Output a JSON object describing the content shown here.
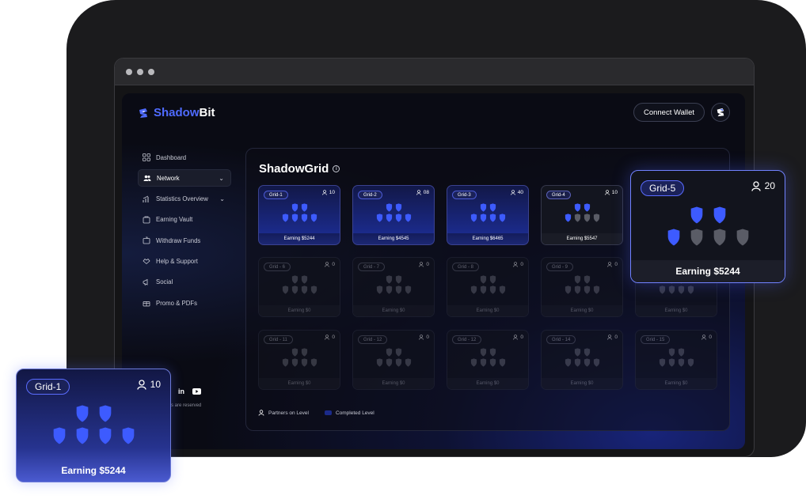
{
  "brand": {
    "name_part1": "Shadow",
    "name_part2": "Bit"
  },
  "header": {
    "connect_label": "Connect Wallet"
  },
  "sidebar": {
    "items": [
      {
        "label": "Dashboard",
        "icon": "dashboard-icon"
      },
      {
        "label": "Network",
        "icon": "users-icon",
        "active": true,
        "expandable": true
      },
      {
        "label": "Statistics Overview",
        "icon": "chart-icon",
        "expandable": true
      },
      {
        "label": "Earning Vault",
        "icon": "vault-icon"
      },
      {
        "label": "Withdraw Funds",
        "icon": "wallet-icon"
      },
      {
        "label": "Help & Support",
        "icon": "support-icon"
      },
      {
        "label": "Social",
        "icon": "megaphone-icon"
      },
      {
        "label": "Promo & PDFs",
        "icon": "gift-icon"
      }
    ],
    "rights_text": "s are reserved"
  },
  "panel": {
    "title": "ShadowGrid"
  },
  "grids": [
    {
      "label": "Grid-1",
      "count": "10",
      "earning": "Earning $5244",
      "state": "on",
      "filled": 6
    },
    {
      "label": "Grid-2",
      "count": "08",
      "earning": "Earning $4545",
      "state": "on",
      "filled": 6
    },
    {
      "label": "Grid-3",
      "count": "40",
      "earning": "Earning $6465",
      "state": "on",
      "filled": 6
    },
    {
      "label": "Grid-4",
      "count": "10",
      "earning": "Earning $5547",
      "state": "mixed",
      "filled": 3
    },
    {
      "label": "Grid - 6",
      "count": "0",
      "earning": "Earning $0",
      "state": "off",
      "filled": 0
    },
    {
      "label": "Grid - 7",
      "count": "0",
      "earning": "Earning $0",
      "state": "off",
      "filled": 0
    },
    {
      "label": "Grid - 8",
      "count": "0",
      "earning": "Earning $0",
      "state": "off",
      "filled": 0
    },
    {
      "label": "Grid - 9",
      "count": "0",
      "earning": "Earning $0",
      "state": "off",
      "filled": 0
    },
    {
      "label": "",
      "count": "",
      "earning": "Earning $0",
      "state": "off",
      "filled": 0
    },
    {
      "label": "Grid - 11",
      "count": "0",
      "earning": "Earning $0",
      "state": "off",
      "filled": 0
    },
    {
      "label": "Grid - 12",
      "count": "0",
      "earning": "Earning $0",
      "state": "off",
      "filled": 0
    },
    {
      "label": "Grid - 12",
      "count": "0",
      "earning": "Earning $0",
      "state": "off",
      "filled": 0
    },
    {
      "label": "Grid - 14",
      "count": "0",
      "earning": "Earning $0",
      "state": "off",
      "filled": 0
    },
    {
      "label": "Grid - 15",
      "count": "0",
      "earning": "Earning $0",
      "state": "off",
      "filled": 0
    }
  ],
  "legend": {
    "partners": "Partners on Level",
    "completed": "Completed Level"
  },
  "popup_right": {
    "label": "Grid-5",
    "count": "20",
    "earning": "Earning $5244",
    "filled": 3
  },
  "popup_left": {
    "label": "Grid-1",
    "count": "10",
    "earning": "Earning $5244",
    "filled": 6
  },
  "colors": {
    "accent": "#4f6bff",
    "shield_on": "#3d5bff",
    "shield_off": "#5a5c66"
  }
}
